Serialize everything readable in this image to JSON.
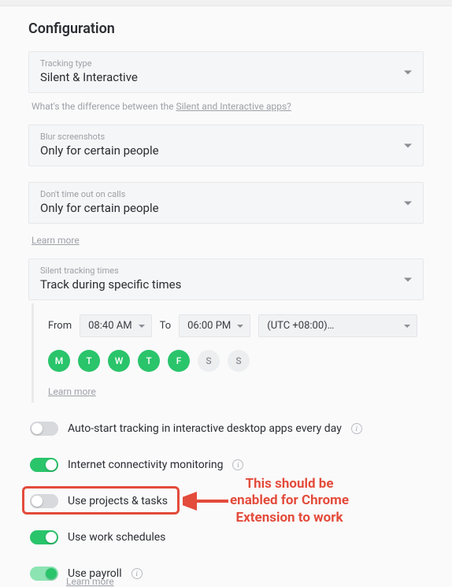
{
  "title": "Configuration",
  "tracking_type": {
    "label": "Tracking type",
    "value": "Silent & Interactive"
  },
  "diff_helper_prefix": "What's the difference between the ",
  "diff_helper_link": "Silent and Interactive apps?",
  "blur": {
    "label": "Blur screenshots",
    "value": "Only for certain people"
  },
  "timeout": {
    "label": "Don't time out on calls",
    "value": "Only for certain people"
  },
  "learn_more": "Learn more",
  "silent_times": {
    "label": "Silent tracking times",
    "value": "Track during specific times"
  },
  "times": {
    "from_label": "From",
    "from_value": "08:40 AM",
    "to_label": "To",
    "to_value": "06:00 PM",
    "tz": "(UTC +08:00)…"
  },
  "days": [
    {
      "letter": "M",
      "active": true
    },
    {
      "letter": "T",
      "active": true
    },
    {
      "letter": "W",
      "active": true
    },
    {
      "letter": "T",
      "active": true
    },
    {
      "letter": "F",
      "active": true
    },
    {
      "letter": "S",
      "active": false
    },
    {
      "letter": "S",
      "active": false
    }
  ],
  "toggles": {
    "autostart": "Auto-start tracking in interactive desktop apps every day",
    "internet": "Internet connectivity monitoring",
    "projects": "Use projects & tasks",
    "schedules": "Use work schedules",
    "payroll": "Use payroll"
  },
  "annotation": {
    "line1": "This should be",
    "line2": "enabled for Chrome",
    "line3": "Extension to work"
  }
}
